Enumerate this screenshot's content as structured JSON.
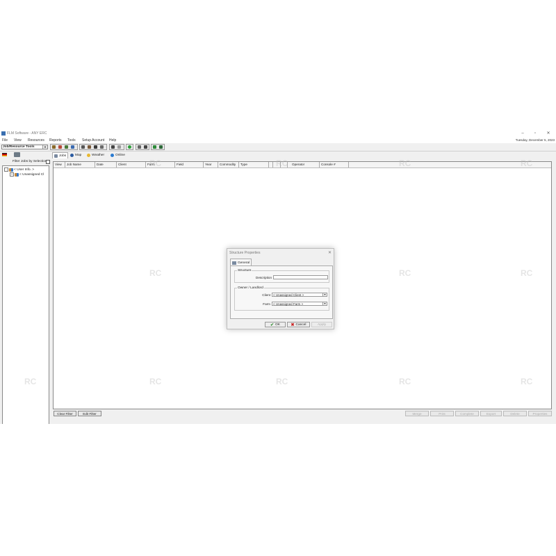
{
  "window": {
    "title": "FLM Software - ANY ERC",
    "date": "Tuesday, December 5, 2023"
  },
  "menu": [
    "File",
    "View",
    "Resources",
    "Reports",
    "Tools",
    "Setup Account",
    "Help"
  ],
  "toolbar": {
    "combo_value": "Job/Resource Tools"
  },
  "left_panel": {
    "filter_label": "Filter Jobs by Selection",
    "tree": [
      {
        "label": "< User Info. >",
        "expander": "-"
      },
      {
        "label": "< Unassigned Cl",
        "expander": "+"
      }
    ]
  },
  "tabs": [
    "Jobs",
    "Map",
    "Weather",
    "Online"
  ],
  "grid": {
    "columns": [
      "View",
      "Job Name",
      "Date",
      "Client",
      "Farm",
      "Field",
      "Year",
      "Commodity",
      "Type",
      "",
      "",
      "Operator",
      "Console #"
    ]
  },
  "bottom_buttons": {
    "clear_filter": "Clear Filter",
    "edit_filter": "Edit Filter",
    "merge": "Merge",
    "print": "Print",
    "complete": "Complete",
    "export": "Export",
    "delete": "Delete",
    "properties": "Properties"
  },
  "dialog": {
    "title": "Structure Properties",
    "tab": "General",
    "structure_group": "Structure",
    "description_label": "Description",
    "description_value": "",
    "owner_group": "Owner / Landlord",
    "client_label": "Client",
    "client_value": "< Unassigned Client >",
    "farm_label": "Farm",
    "farm_value": "< Unassigned Farm >",
    "ok": "OK",
    "cancel": "Cancel",
    "apply": "Apply"
  },
  "watermark": "RC"
}
